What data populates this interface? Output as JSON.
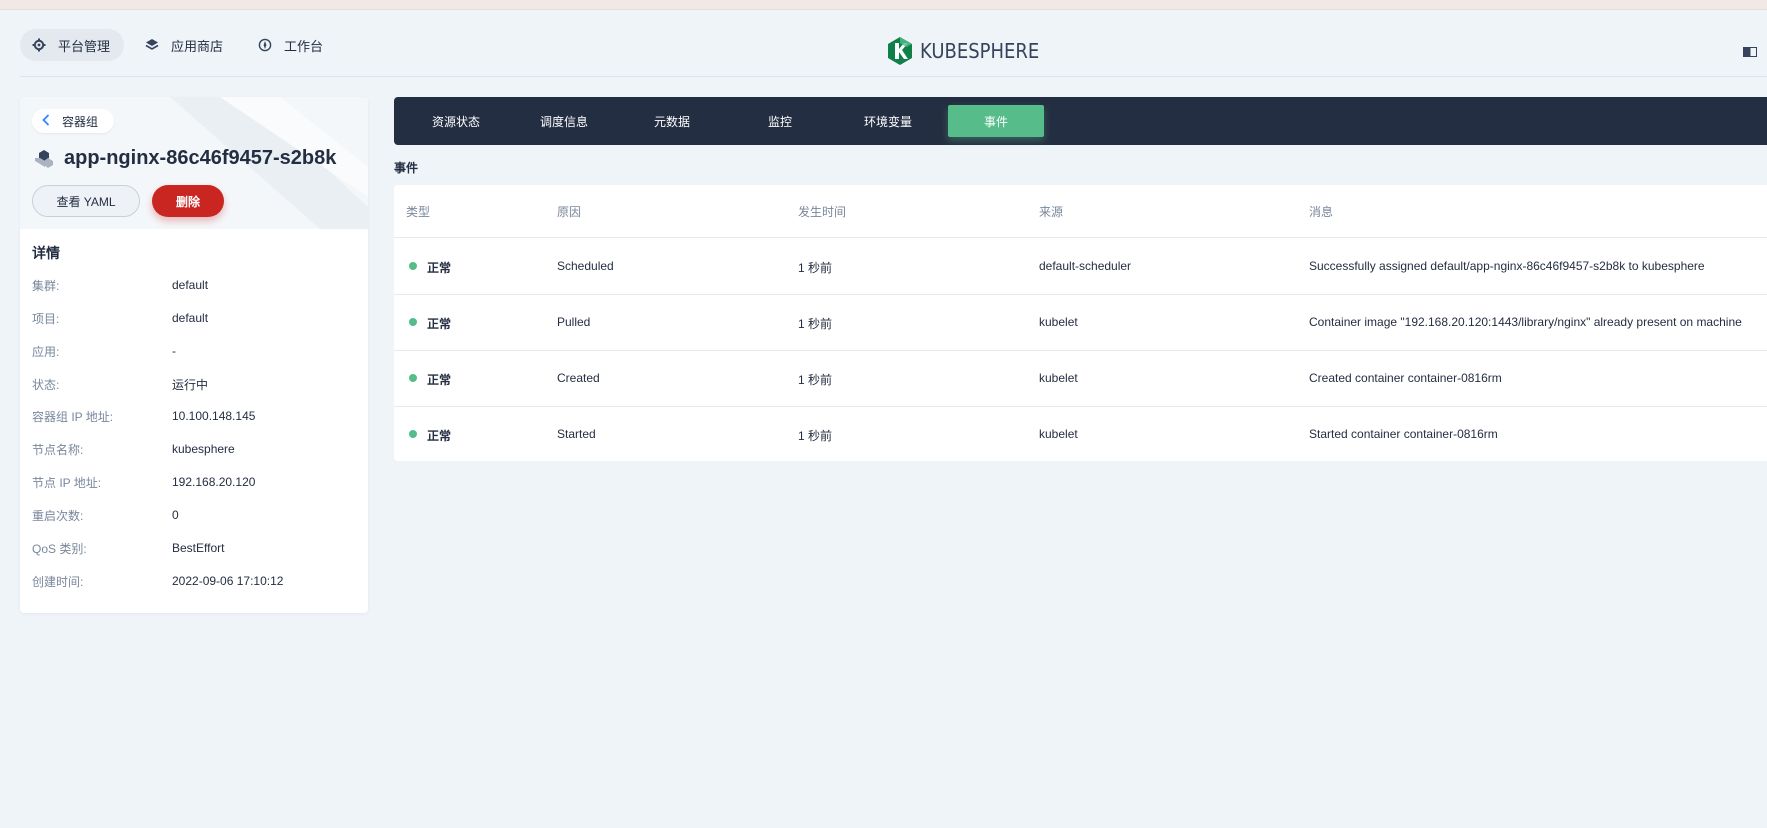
{
  "topnav": {
    "items": [
      {
        "label": "平台管理",
        "icon": "gear-icon"
      },
      {
        "label": "应用商店",
        "icon": "layers-icon"
      },
      {
        "label": "工作台",
        "icon": "compass-icon"
      }
    ],
    "logo_text": "KUBESPHERE"
  },
  "colors": {
    "brand_green": "#55bc8a",
    "dark_nav": "#242e42",
    "danger": "#ca2621",
    "background": "#eff4f9"
  },
  "pod": {
    "back_label": "容器组",
    "name": "app-nginx-86c46f9457-s2b8k",
    "view_yaml_label": "查看 YAML",
    "delete_label": "删除"
  },
  "details": {
    "title": "详情",
    "rows": [
      {
        "label": "集群:",
        "value": "default"
      },
      {
        "label": "项目:",
        "value": "default"
      },
      {
        "label": "应用:",
        "value": "-"
      },
      {
        "label": "状态:",
        "value": "运行中"
      },
      {
        "label": "容器组 IP 地址:",
        "value": "10.100.148.145"
      },
      {
        "label": "节点名称:",
        "value": "kubesphere"
      },
      {
        "label": "节点 IP 地址:",
        "value": "192.168.20.120"
      },
      {
        "label": "重启次数:",
        "value": "0"
      },
      {
        "label": "QoS 类别:",
        "value": "BestEffort"
      },
      {
        "label": "创建时间:",
        "value": "2022-09-06 17:10:12"
      }
    ]
  },
  "tabs": [
    {
      "label": "资源状态",
      "active": false
    },
    {
      "label": "调度信息",
      "active": false
    },
    {
      "label": "元数据",
      "active": false
    },
    {
      "label": "监控",
      "active": false
    },
    {
      "label": "环境变量",
      "active": false
    },
    {
      "label": "事件",
      "active": true
    }
  ],
  "events": {
    "section_label": "事件",
    "columns": [
      "类型",
      "原因",
      "发生时间",
      "来源",
      "消息"
    ],
    "rows": [
      {
        "type": "正常",
        "reason": "Scheduled",
        "time": "1 秒前",
        "source": "default-scheduler",
        "message": "Successfully assigned default/app-nginx-86c46f9457-s2b8k to kubesphere"
      },
      {
        "type": "正常",
        "reason": "Pulled",
        "time": "1 秒前",
        "source": "kubelet",
        "message": "Container image \"192.168.20.120:1443/library/nginx\" already present on machine"
      },
      {
        "type": "正常",
        "reason": "Created",
        "time": "1 秒前",
        "source": "kubelet",
        "message": "Created container container-0816rm"
      },
      {
        "type": "正常",
        "reason": "Started",
        "time": "1 秒前",
        "source": "kubelet",
        "message": "Started container container-0816rm"
      }
    ]
  }
}
